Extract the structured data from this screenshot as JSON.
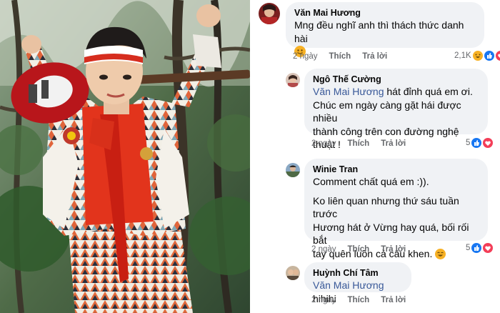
{
  "comments": [
    {
      "author": "Văn Mai Hương",
      "text": "Mng đều nghĩ anh thì thách thức danh hài",
      "time": "2 ngày",
      "like_label": "Thích",
      "reply_label": "Trả lời",
      "reaction_count": "2,1K",
      "reaction_icons": [
        "haha-icon",
        "like-icon",
        "love-icon"
      ]
    },
    {
      "author": "Ngô Thế Cường",
      "mention": "Văn Mai Hương",
      "text_after_mention": " hát đỉnh quá em ơi.",
      "text_lines": [
        "Chúc em ngày càng gặt hái được nhiều",
        "thành công trên con đường  nghệ",
        "thuật !"
      ],
      "time": "2 ngày",
      "like_label": "Thích",
      "reply_label": "Trả lời",
      "reaction_count": "5",
      "reaction_icons": [
        "like-icon",
        "love-icon"
      ]
    },
    {
      "author": "Winie Tran",
      "text_lines": [
        "Comment chất quá em :)).",
        "",
        "Ko liên quan nhưng thứ sáu tuần trước",
        "Hương hát ở Vừng hay quá, bối rối bắt",
        "tay quên luôn cả câu khen."
      ],
      "time": "2 ngày",
      "like_label": "Thích",
      "reply_label": "Trả lời",
      "reaction_count": "5",
      "reaction_icons": [
        "like-icon",
        "love-icon"
      ]
    },
    {
      "author": "Huỳnh Chí Tâm",
      "mention": "Văn Mai Hương",
      "text_after_mention": " hihihi",
      "time": "2 ngày",
      "like_label": "Thích",
      "reply_label": "Trả lời"
    }
  ],
  "colors": {
    "bubble": "#f0f2f5",
    "mention": "#385898",
    "meta": "#65676b",
    "like": "#1877f2",
    "love": "#f33e58",
    "haha": "#f7b125"
  }
}
